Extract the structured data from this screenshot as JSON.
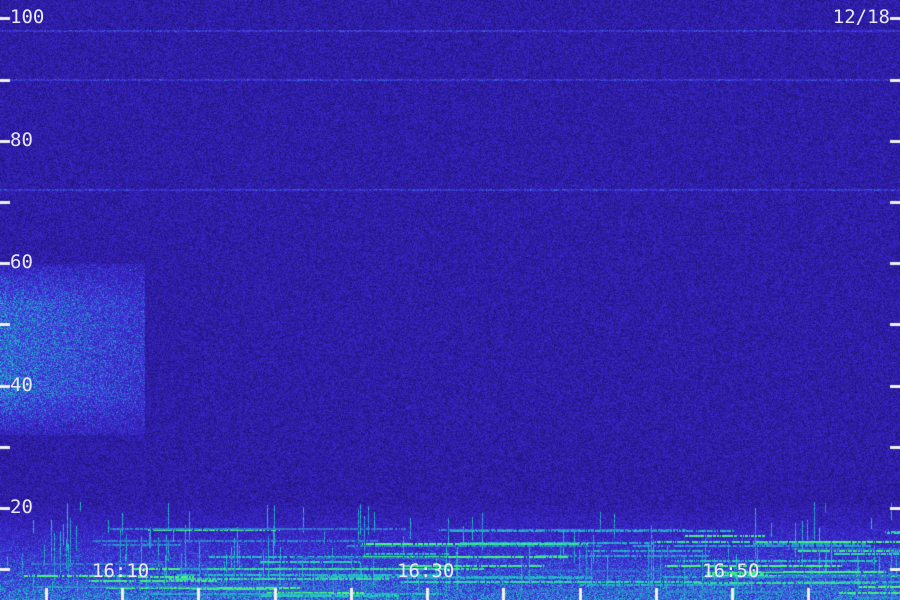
{
  "date_label": "12/18",
  "chart_data": {
    "type": "heatmap",
    "y_ticks": [
      "100",
      "80",
      "60",
      "40",
      "20"
    ],
    "y_tick_values": [
      100,
      80,
      60,
      40,
      20
    ],
    "y_minor_tick_values": [
      90,
      70,
      50,
      30,
      10
    ],
    "ylim": [
      5,
      103
    ],
    "x_ticks": [
      "16:10",
      "16:30",
      "16:50"
    ],
    "x_tick_values": [
      10,
      30,
      50
    ],
    "x_minor_tick_values": [
      5,
      15,
      20,
      25,
      35,
      40,
      45,
      55
    ],
    "xlim": [
      2,
      61
    ],
    "grid": false,
    "colormap": {
      "low": "#140a6e",
      "mid": "#3c3cdc",
      "high": "#3cf0a0"
    },
    "features": [
      {
        "name": "narrow band",
        "y": 98
      },
      {
        "name": "narrow band",
        "y": 90
      },
      {
        "name": "narrow band",
        "y": 72
      },
      {
        "name": "broadband burst",
        "x": [
          2,
          11.5
        ],
        "y": [
          32,
          60
        ]
      },
      {
        "name": "low-frequency noise",
        "y": [
          5,
          21
        ]
      }
    ]
  }
}
